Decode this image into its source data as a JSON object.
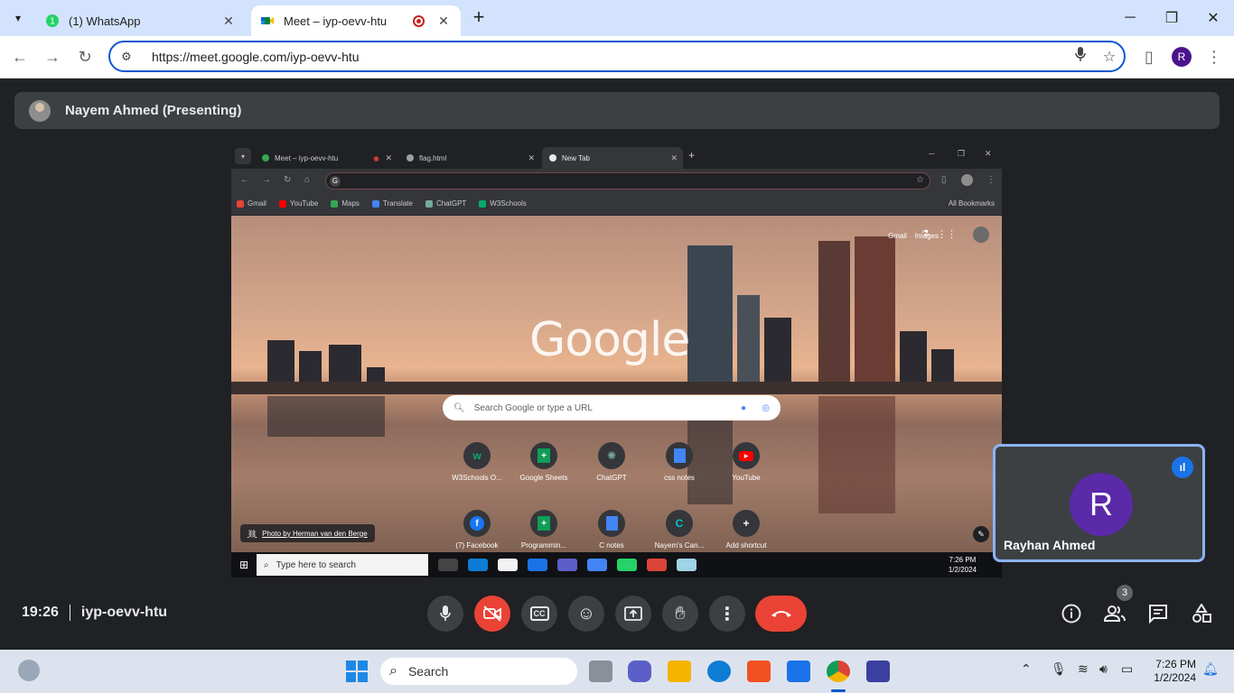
{
  "browser": {
    "tabs": [
      {
        "title": "(1) WhatsApp",
        "icon": "whatsapp-icon",
        "close": "✕"
      },
      {
        "title": "Meet – iyp-oevv-htu",
        "icon": "meet-icon",
        "close": "✕"
      }
    ],
    "new_tab": "+",
    "url": "https://meet.google.com/iyp-oevv-htu",
    "profile_initial": "R"
  },
  "meet": {
    "presenter_label": "Nayem Ahmed (Presenting)",
    "time": "19:26",
    "code": "iyp-oevv-htu",
    "participant_count": "3",
    "self": {
      "initial": "R",
      "name": "Rayhan Ahmed"
    },
    "accent_color": "#8ab4f8",
    "end_call_color": "#ea4335"
  },
  "shared_screen": {
    "tabs": [
      {
        "title": "Meet – iyp-oevv-htu"
      },
      {
        "title": "flag.html"
      },
      {
        "title": "New Tab"
      }
    ],
    "bookmarks": [
      "Gmail",
      "YouTube",
      "Maps",
      "Translate",
      "ChatGPT",
      "W3Schools"
    ],
    "all_bookmarks": "All Bookmarks",
    "top_links": {
      "gmail": "Gmail",
      "images": "Images"
    },
    "logo": "Google",
    "search_placeholder": "Search Google or type a URL",
    "shortcuts_row1": [
      "W3Schools O...",
      "Google Sheets",
      "ChatGPT",
      "css notes",
      "YouTube"
    ],
    "shortcuts_row2": [
      "(7) Facebook",
      "Programmin...",
      "C notes",
      "Nayem's Can...",
      "Add shortcut"
    ],
    "photo_credit": "Photo by Herman van den Berge",
    "taskbar_search": "Type here to search",
    "clock_time": "7:26 PM",
    "clock_date": "1/2/2024"
  },
  "os_taskbar": {
    "search": "Search",
    "time": "7:26 PM",
    "date": "1/2/2024"
  }
}
